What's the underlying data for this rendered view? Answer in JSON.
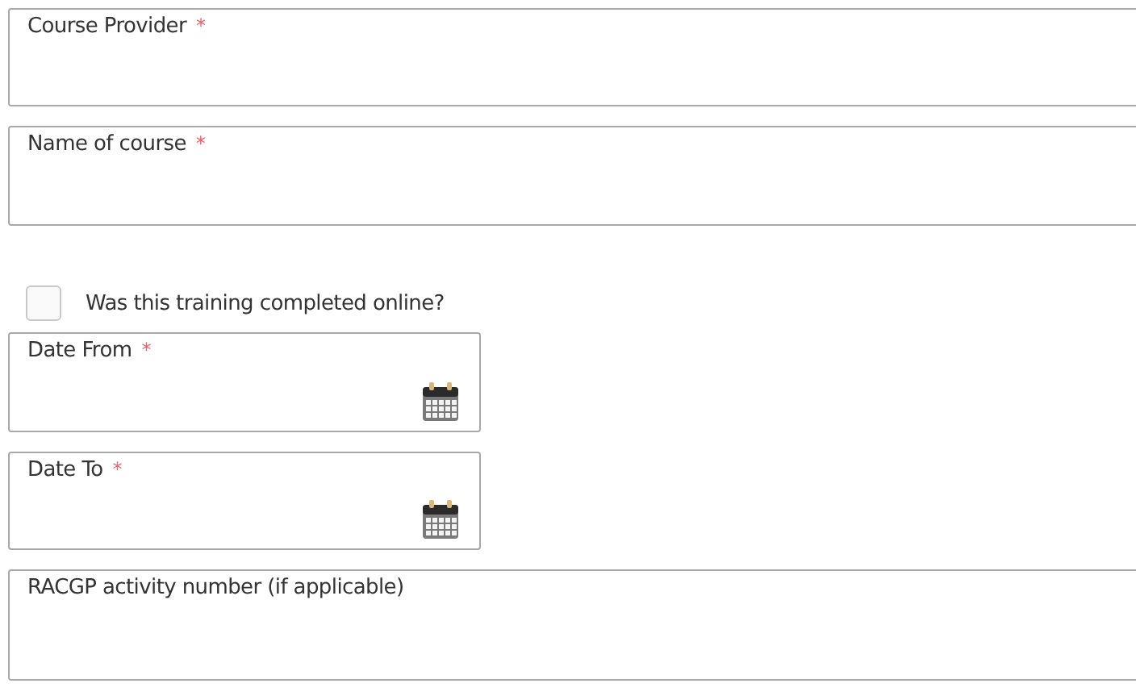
{
  "fields": [
    {
      "kind": "text",
      "label": "Course Provider",
      "required_mark": "*"
    },
    {
      "kind": "text",
      "label": "Name of course",
      "required_mark": "*"
    },
    {
      "kind": "checkbox",
      "label": "Was this training completed online?",
      "checked": false
    },
    {
      "kind": "date",
      "label": "Date From",
      "required_mark": "*"
    },
    {
      "kind": "date",
      "label": "Date To",
      "required_mark": "*"
    },
    {
      "kind": "text",
      "label": "RACGP activity number (if applicable)"
    }
  ]
}
